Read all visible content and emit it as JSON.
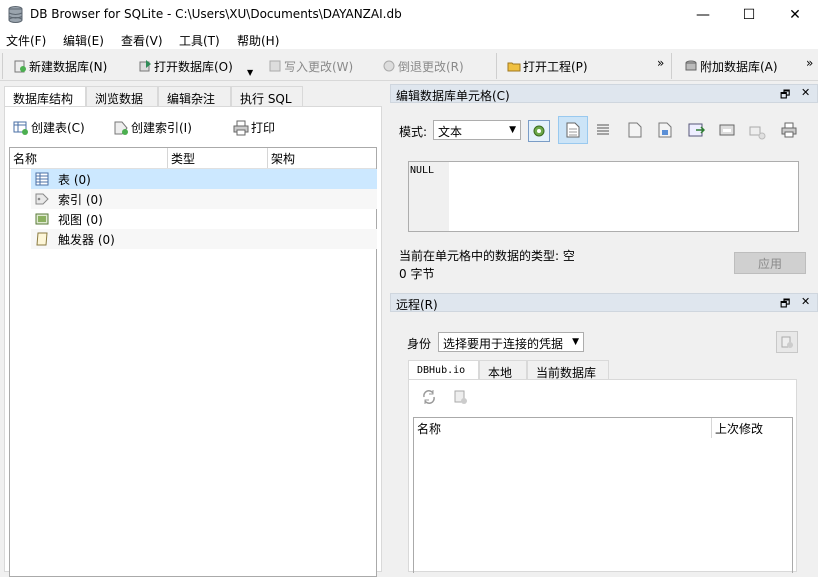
{
  "window": {
    "title": "DB Browser for SQLite - C:\\Users\\XU\\Documents\\DAYANZAI.db",
    "minimize": "—",
    "maximize": "☐",
    "close": "✕"
  },
  "menu": [
    "文件(F)",
    "编辑(E)",
    "查看(V)",
    "工具(T)",
    "帮助(H)"
  ],
  "toolbar": {
    "new_db": "新建数据库(N)",
    "open_db": "打开数据库(O)",
    "write_changes": "写入更改(W)",
    "revert_changes": "倒退更改(R)",
    "open_project": "打开工程(P)",
    "attach_db": "附加数据库(A)",
    "overflow": "»"
  },
  "left_tabs": [
    "数据库结构",
    "浏览数据",
    "编辑杂注",
    "执行 SQL"
  ],
  "structure": {
    "create_table": "创建表(C)",
    "create_index": "创建索引(I)",
    "print": "打印",
    "columns": [
      "名称",
      "类型",
      "架构"
    ],
    "rows": [
      {
        "label": "表 (0)",
        "icon": "table-icon"
      },
      {
        "label": "索引 (0)",
        "icon": "index-icon"
      },
      {
        "label": "视图 (0)",
        "icon": "view-icon"
      },
      {
        "label": "触发器 (0)",
        "icon": "trigger-icon"
      }
    ]
  },
  "edit_cell": {
    "title": "编辑数据库单元格(C)",
    "float": "🗗",
    "close": "✕",
    "mode_label": "模式:",
    "mode_value": "文本",
    "content": "NULL",
    "type_text": "当前在单元格中的数据的类型: 空",
    "size_text": "0 字节",
    "apply": "应用"
  },
  "remote": {
    "title": "远程(R)",
    "float": "🗗",
    "close": "✕",
    "identity_label": "身份",
    "identity_value": "选择要用于连接的凭据",
    "tabs": [
      "DBHub.io",
      "本地",
      "当前数据库"
    ],
    "columns": [
      "名称",
      "上次修改"
    ]
  },
  "colors": {
    "selection": "#cce8ff",
    "panel_title": "#dfe6ee"
  }
}
